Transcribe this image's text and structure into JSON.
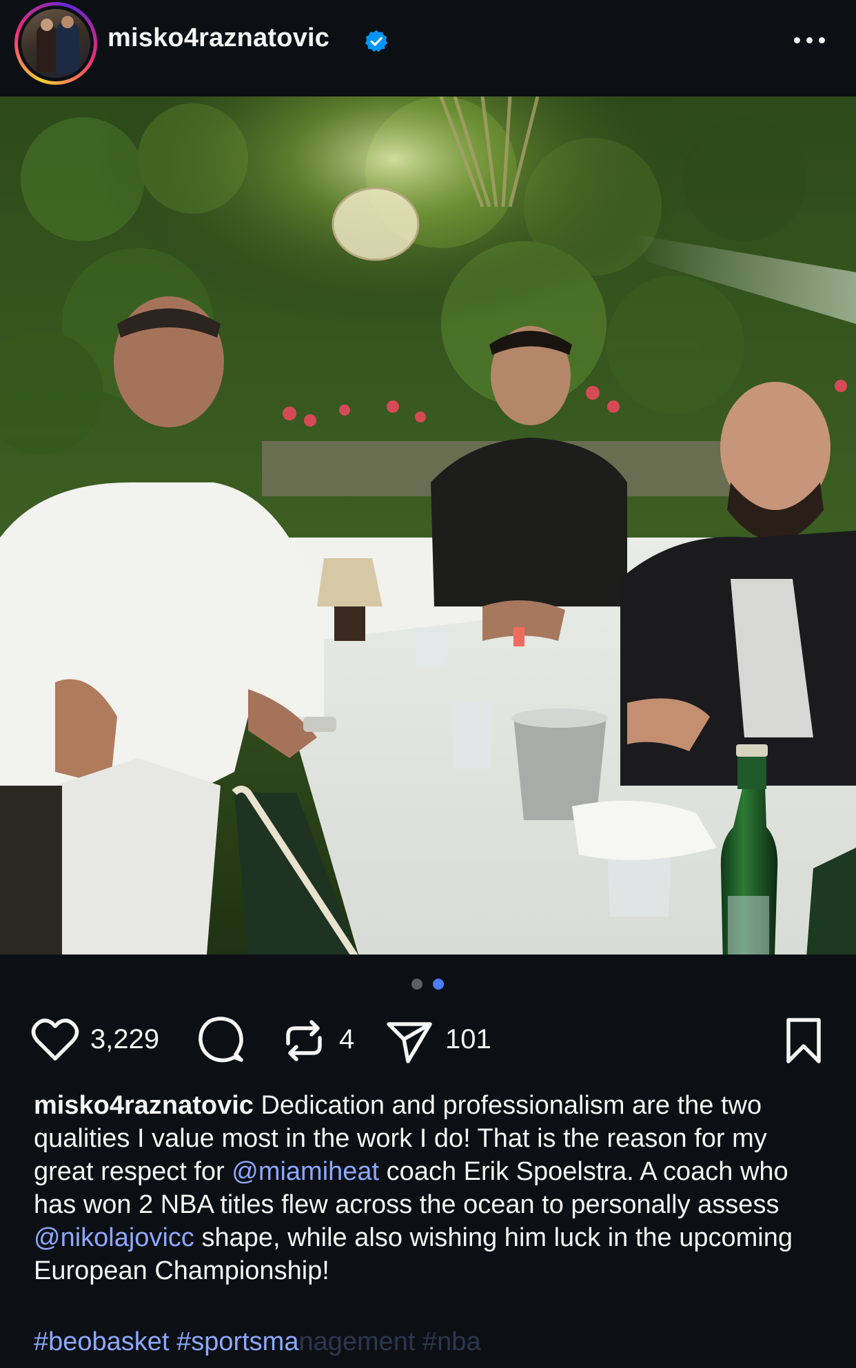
{
  "header": {
    "username": "misko4raznatovic",
    "verified_icon": "verified-badge-icon",
    "more_icon": "more-horizontal-icon"
  },
  "post": {
    "photo_description_icon": "dinner-table-photo",
    "carousel": {
      "count": 2,
      "active_index": 1
    }
  },
  "actions": {
    "likes": "3,229",
    "reposts": "4",
    "shares": "101",
    "icons": [
      "heart-icon",
      "comment-icon",
      "repost-icon",
      "send-icon",
      "bookmark-icon"
    ]
  },
  "caption": {
    "username": "misko4raznatovic",
    "text_1": " Dedication and professionalism are the two qualities I value most in the work I do! That is the reason for my great respect for ",
    "mention_1": "@miamiheat",
    "text_2": " coach Erik Spoelstra. A coach who has won 2 NBA titles flew across the ocean to personally assess ",
    "mention_2": "@nikolajovicc",
    "text_3": " shape, while also wishing him luck in the upcoming European Championship!",
    "hashtag_1": "#beobasket",
    "hashtag_2": "#sportsma",
    "hashtag_faded": "nagement #nba"
  },
  "colors": {
    "background": "#0c1014",
    "text": "#f5f5f5",
    "link": "#8ea8ff",
    "verified": "#0095f6",
    "dot_active": "#4a7dff",
    "dot_inactive": "#5b5f66"
  }
}
